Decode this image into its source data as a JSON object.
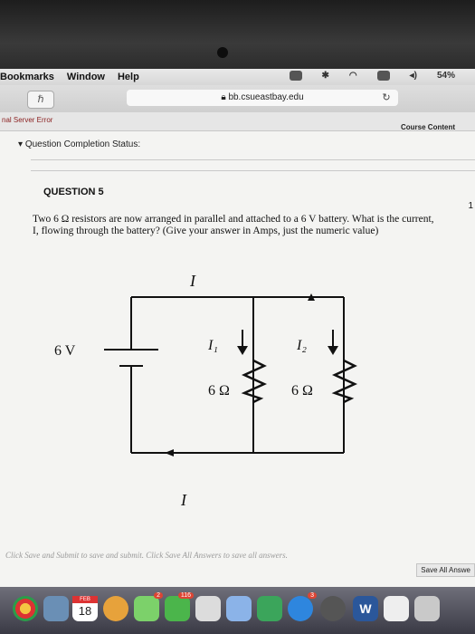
{
  "menubar": {
    "items": [
      "Bookmarks",
      "Window",
      "Help"
    ],
    "battery": "54%"
  },
  "browser": {
    "url": "bb.csueastbay.edu"
  },
  "page": {
    "error_text": "nal Server Error",
    "course_content": "Course Content"
  },
  "content": {
    "status_label": "Question Completion Status:",
    "question_heading": "QUESTION 5",
    "question_number": "1",
    "question_text": "Two 6 Ω resistors are now arranged in parallel and attached to a 6 V battery. What is the current, I, flowing through the battery? (Give your answer in Amps, just the numeric value)",
    "circuit": {
      "battery_label": "6 V",
      "current_top": "I",
      "current_bottom": "I",
      "branch1_current": "I₁",
      "branch2_current": "I₂",
      "r1_label": "6 Ω",
      "r2_label": "6 Ω"
    },
    "footer_note": "Click Save and Submit to save and submit. Click Save All Answers to save all answers.",
    "save_all_button": "Save All Answe"
  },
  "dock": {
    "calendar_month": "FEB",
    "calendar_day": "18",
    "badges": [
      "2",
      "116",
      "3"
    ]
  }
}
